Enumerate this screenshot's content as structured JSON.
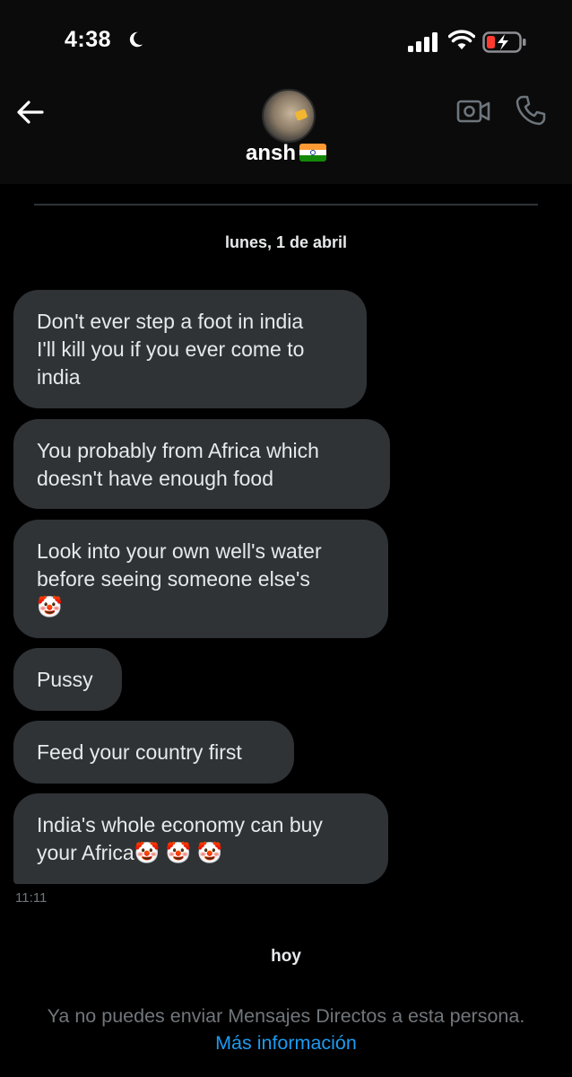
{
  "status_bar": {
    "time": "4:38",
    "moon_icon": "moon-icon",
    "signal_icon": "cellular-signal-icon",
    "wifi_icon": "wifi-icon",
    "battery_icon": "battery-low-charging-icon",
    "battery_color": "#ff3b30"
  },
  "header": {
    "back_icon": "arrow-left-icon",
    "avatar_icon": "cat-avatar",
    "name": "ansh",
    "flag": "🇮🇳",
    "video_icon": "video-call-icon",
    "call_icon": "phone-icon"
  },
  "conversation": {
    "date_label": "lunes, 1 de abril",
    "messages": [
      {
        "text": "Don't ever step a foot in india\nI'll kill you if you ever come to\nindia"
      },
      {
        "text": "You probably from Africa which\ndoesn't have enough food"
      },
      {
        "text": "Look into your own well's water\nbefore seeing someone else's\n🤡"
      },
      {
        "text": "Pussy"
      },
      {
        "text": "Feed your country first"
      },
      {
        "text": "India's whole economy can buy\nyour Africa🤡 🤡 🤡"
      }
    ],
    "last_message_time": "11:11",
    "today_label": "hoy"
  },
  "footer": {
    "notice": "Ya no puedes enviar Mensajes Directos a esta persona.",
    "more_link": "Más información"
  },
  "colors": {
    "background": "#000000",
    "bubble": "#2f3336",
    "text": "#e7e9ea",
    "muted": "#71767b",
    "link": "#1d9bf0"
  }
}
